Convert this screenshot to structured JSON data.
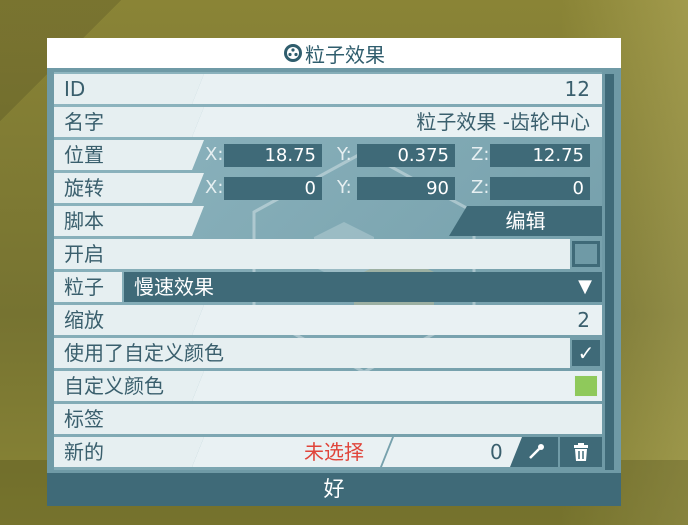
{
  "dialog": {
    "title": "粒子效果",
    "ok_label": "好"
  },
  "rows": {
    "id": {
      "label": "ID",
      "value": "12"
    },
    "name": {
      "label": "名字",
      "value": "粒子效果 -齿轮中心"
    },
    "position": {
      "label": "位置",
      "x_label": "X:",
      "x": "18.75",
      "y_label": "Y:",
      "y": "0.375",
      "z_label": "Z:",
      "z": "12.75"
    },
    "rotation": {
      "label": "旋转",
      "x_label": "X:",
      "x": "0",
      "y_label": "Y:",
      "y": "90",
      "z_label": "Z:",
      "z": "0"
    },
    "script": {
      "label": "脚本",
      "edit_label": "编辑"
    },
    "enabled": {
      "label": "开启",
      "checked": false
    },
    "particle": {
      "label": "粒子",
      "selected": "慢速效果",
      "dropdown_glyph": "▼"
    },
    "scale": {
      "label": "缩放",
      "value": "2"
    },
    "use_custom_color": {
      "label": "使用了自定义颜色",
      "checked": true,
      "check_glyph": "✓"
    },
    "custom_color": {
      "label": "自定义颜色",
      "color": "#8fc95b"
    },
    "tag": {
      "label": "标签",
      "value": ""
    },
    "new": {
      "label": "新的",
      "unselected_text": "未选择",
      "count": "0",
      "eyedropper_icon": "eyedropper-icon",
      "trash_icon": "trash-icon"
    }
  },
  "colors": {
    "panel_dark": "#3f6a78",
    "label_bg": "#e6eff1",
    "warning_text": "#e0443a"
  }
}
